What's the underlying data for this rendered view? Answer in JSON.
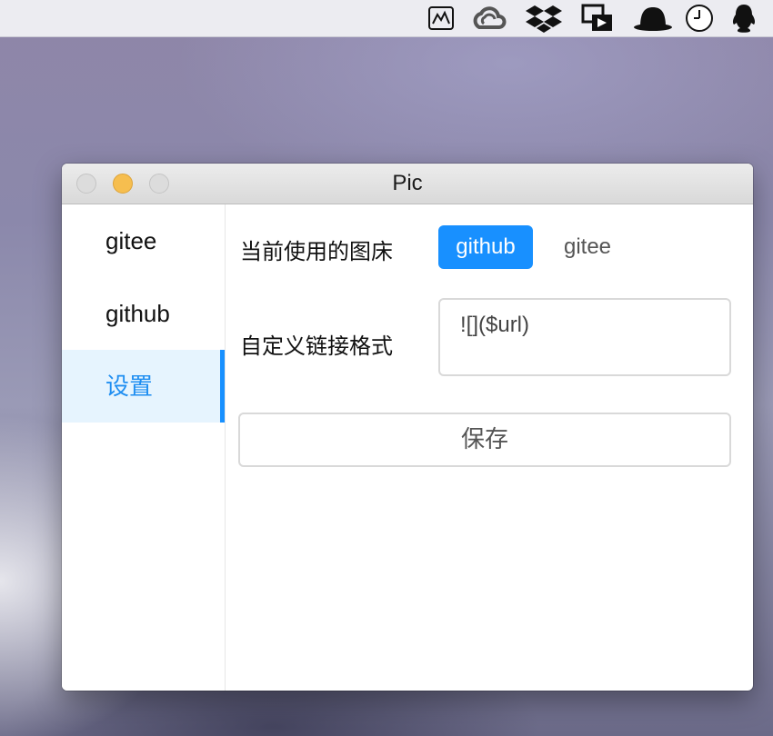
{
  "menubar": {
    "icons": [
      "monitor-chart-icon",
      "creative-cloud-icon",
      "dropbox-icon",
      "screen-share-icon",
      "bowler-hat-icon",
      "clock-icon",
      "qq-penguin-icon"
    ]
  },
  "window": {
    "title": "Pic",
    "sidebar": {
      "items": [
        {
          "label": "gitee"
        },
        {
          "label": "github"
        },
        {
          "label": "设置"
        }
      ],
      "active": "设置",
      "accent_color": "#1890ff"
    },
    "settings": {
      "current_bed_label": "当前使用的图床",
      "bed_options": [
        {
          "label": "github",
          "selected": true
        },
        {
          "label": "gitee",
          "selected": false
        }
      ],
      "link_format_label": "自定义链接格式",
      "link_format_value": "![]($url)",
      "save_label": "保存"
    }
  }
}
